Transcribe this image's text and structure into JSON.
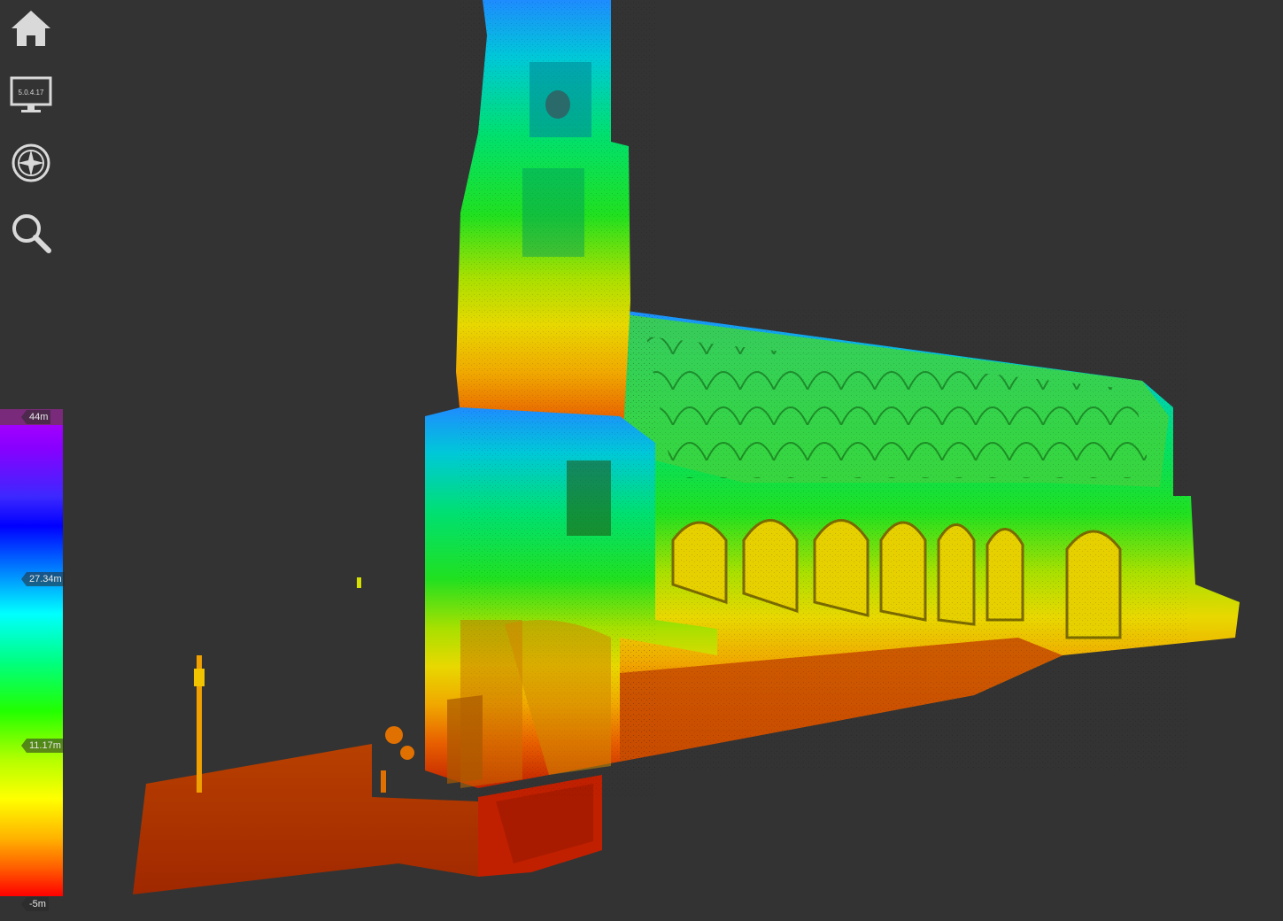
{
  "toolbar": {
    "home_icon": "home-icon",
    "display_icon": "monitor-icon",
    "display_version": "5.0.4.17",
    "navigation_icon": "compass-icon",
    "search_icon": "search-icon"
  },
  "legend": {
    "max_label": "44m",
    "mid_high_label": "27.34m",
    "mid_low_label": "11.17m",
    "min_label": "-5m"
  },
  "colors": {
    "background": "#333333",
    "icon": "#d9d9d9"
  }
}
